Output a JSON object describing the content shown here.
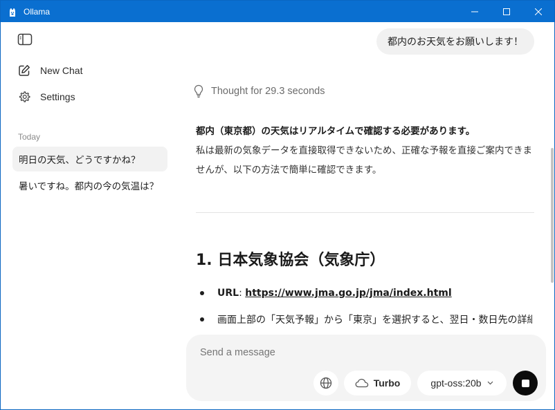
{
  "window": {
    "title": "Ollama",
    "accent": "#0a6fd0"
  },
  "sidebar": {
    "toggle_icon": "sidebar-toggle-icon",
    "nav": [
      {
        "label": "New Chat",
        "icon": "new-chat-icon"
      },
      {
        "label": "Settings",
        "icon": "gear-icon"
      }
    ],
    "section_label": "Today",
    "history": [
      {
        "label": "明日の天気、どうですかね？",
        "active": true
      },
      {
        "label": "暑いですね。都内の今の気温は？",
        "active": false
      }
    ]
  },
  "conversation": {
    "user_message": "都内のお天気をお願いします！",
    "thought": "Thought for 29.3 seconds",
    "answer_lead": "都内（東京都）の天気はリアルタイムで確認する必要があります。",
    "answer_body": "私は最新の気象データを直接取得できないため、正確な予報を直接ご案内できませんが、以下の方法で簡単に確認できます。",
    "section_heading": "1. 日本気象協会（気象庁）",
    "bullets": [
      {
        "label": "URL",
        "separator": ": ",
        "link": "https://www.jma.go.jp/jma/index.html"
      },
      {
        "text": "画面上部の「天気予報」から「東京」を選択すると、翌日・数日先の詳細"
      }
    ]
  },
  "composer": {
    "placeholder": "Send a message",
    "turbo_label": "Turbo",
    "model": "gpt-oss:20b",
    "globe_icon": "globe-icon",
    "stop_icon": "stop-icon"
  }
}
